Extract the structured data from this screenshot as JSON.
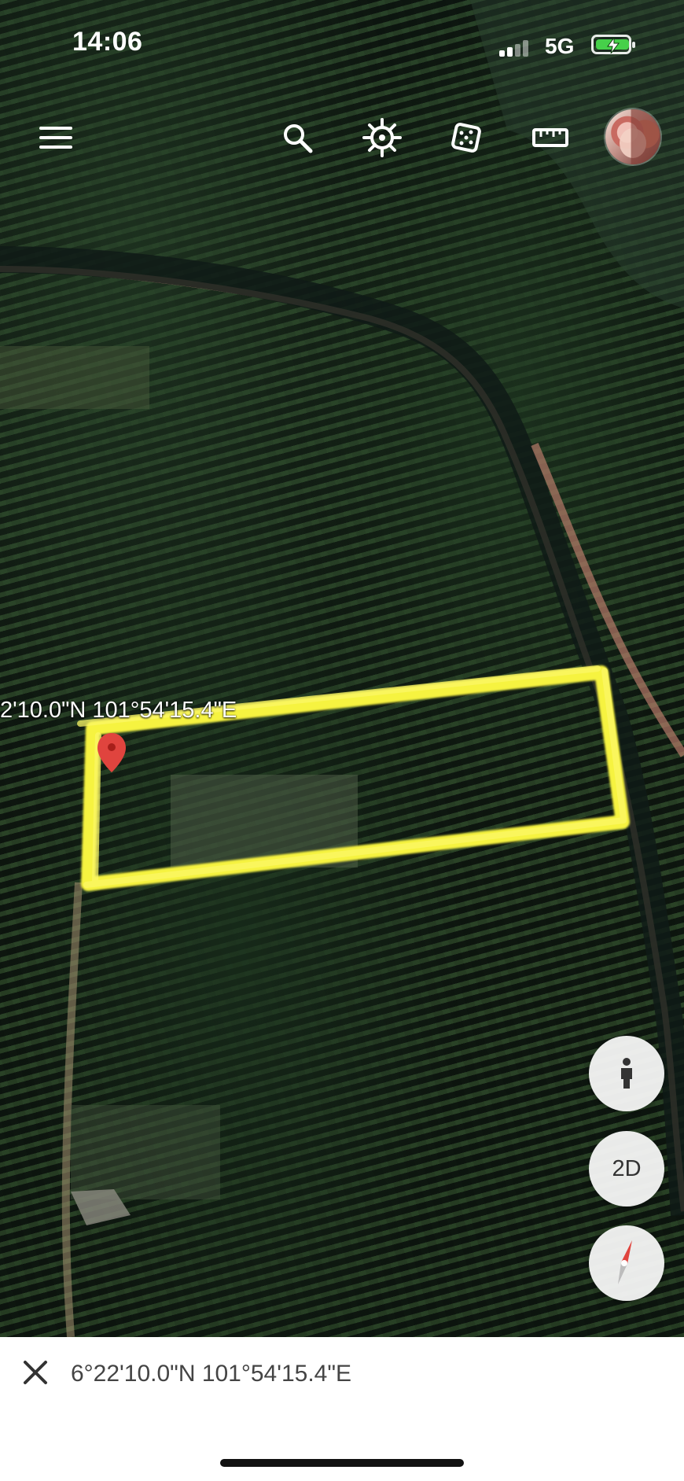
{
  "status_bar": {
    "time": "14:06",
    "network": "5G"
  },
  "toolbar": {
    "icons": [
      "menu-icon",
      "search-icon",
      "voyager-icon",
      "feeling-lucky-icon",
      "measure-icon",
      "avatar"
    ]
  },
  "map": {
    "pin_label": "2'10.0\"N 101°54'15.4\"E",
    "highlight_color": "#f6f33f",
    "pin_color": "#e0443e"
  },
  "controls": {
    "view_mode": "2D"
  },
  "bottom_sheet": {
    "coordinates": "6°22'10.0\"N 101°54'15.4\"E"
  },
  "colors": {
    "sheet_background": "#ffffff",
    "button_background": "#f6f6f6",
    "battery_green": "#46d04a"
  }
}
